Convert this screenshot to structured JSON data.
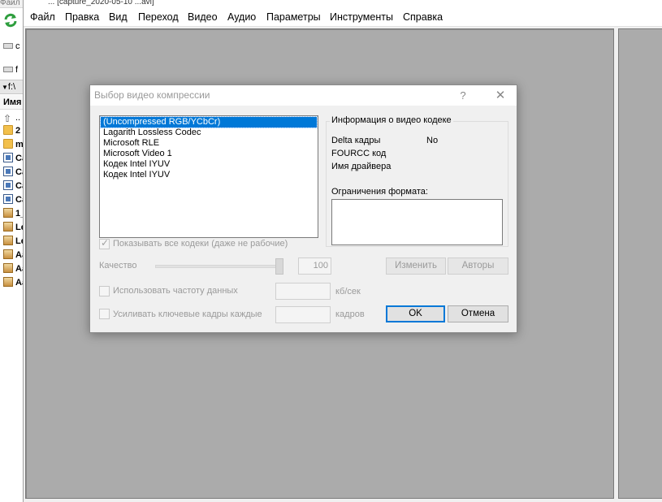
{
  "window": {
    "title_fragment": "... [capture_2020-05-10 ...avi]"
  },
  "menu": [
    {
      "label": "Файл"
    },
    {
      "label": "Правка"
    },
    {
      "label": "Вид"
    },
    {
      "label": "Переход"
    },
    {
      "label": "Видео"
    },
    {
      "label": "Аудио"
    },
    {
      "label": "Параметры"
    },
    {
      "label": "Инструменты"
    },
    {
      "label": "Справка"
    }
  ],
  "file_panel": {
    "top_label": "Файл",
    "drive_c": "c",
    "drive_f": "f",
    "path": "f:\\",
    "column_name": "Имя",
    "up_entry": "..",
    "rows": [
      {
        "label": "2",
        "icon": "folder-icon"
      },
      {
        "label": "m",
        "icon": "folder-icon"
      },
      {
        "label": "Ca",
        "icon": "video-file-icon"
      },
      {
        "label": "Ca",
        "icon": "video-file-icon"
      },
      {
        "label": "Ca",
        "icon": "video-file-icon"
      },
      {
        "label": "Ca",
        "icon": "video-file-icon"
      },
      {
        "label": "1_",
        "icon": "image-file-icon"
      },
      {
        "label": "Le",
        "icon": "image-file-icon"
      },
      {
        "label": "Le",
        "icon": "image-file-icon"
      },
      {
        "label": "Aa",
        "icon": "image-file-icon"
      },
      {
        "label": "Aa",
        "icon": "image-file-icon"
      },
      {
        "label": "Aa",
        "icon": "image-file-icon"
      }
    ]
  },
  "dialog": {
    "title": "Выбор видео компрессии",
    "help": "?",
    "close": "✕",
    "codecs": [
      "(Uncompressed RGB/YCbCr)",
      "Lagarith Lossless Codec",
      "Microsoft RLE",
      "Microsoft Video 1",
      "Кодек Intel IYUV",
      "Кодек Intel IYUV"
    ],
    "selected_codec_index": 0,
    "info": {
      "legend": "Информация о видео кодеке",
      "delta_label": "Delta кадры",
      "delta_value": "No",
      "fourcc_label": "FOURCC код",
      "driver_label": "Имя драйвера",
      "restrictions_label": "Ограничения формата:"
    },
    "show_all": {
      "label": "Показывать все кодеки (даже не рабочие)",
      "checked": true
    },
    "quality": {
      "label": "Качество",
      "value": "100",
      "level_percent": 100
    },
    "buttons": {
      "change": "Изменить",
      "authors": "Авторы",
      "ok": "OK",
      "cancel": "Отмена"
    },
    "data_rate": {
      "label": "Использовать частоту данных",
      "unit": "кб/сек",
      "checked": false,
      "value": ""
    },
    "keyframes": {
      "label": "Усиливать ключевые кадры каждые",
      "unit": "кадров",
      "checked": false,
      "value": ""
    }
  },
  "colors": {
    "selection": "#0078d7",
    "workspace": "#ababab",
    "disabled_text": "#9a9a9a"
  }
}
